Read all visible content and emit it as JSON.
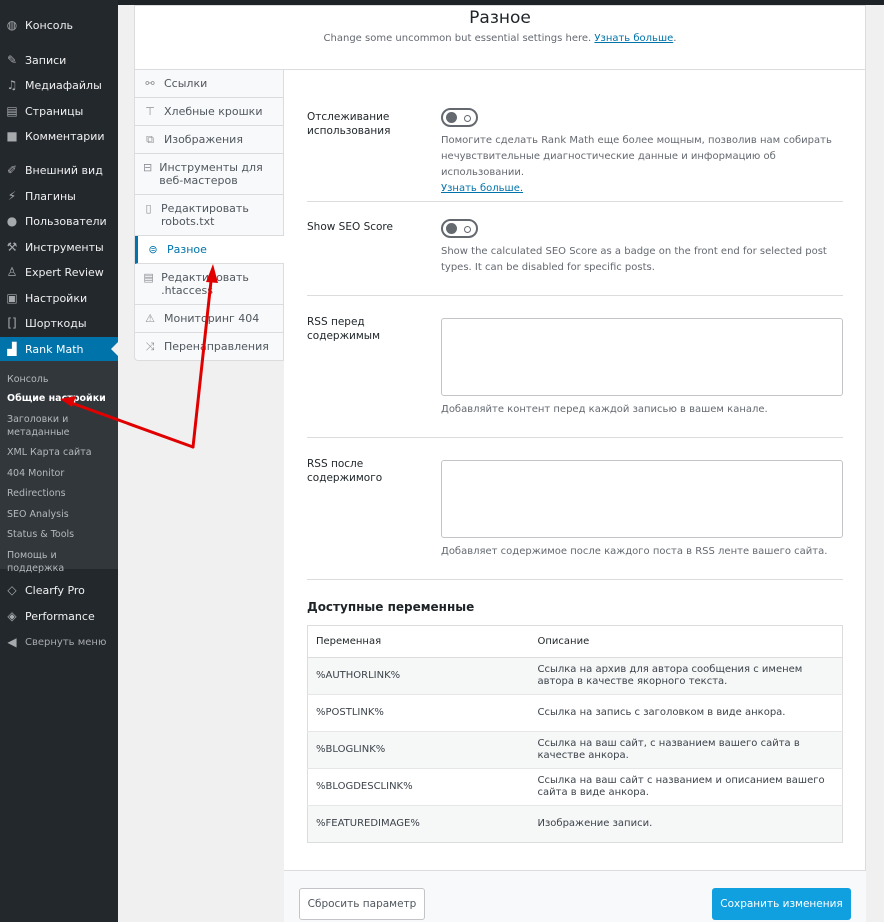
{
  "sidebar": {
    "items": [
      {
        "label": "Консоль",
        "icon": "dashboard-icon"
      },
      {
        "label": "Записи",
        "icon": "pin-icon"
      },
      {
        "label": "Медиафайлы",
        "icon": "media-icon"
      },
      {
        "label": "Страницы",
        "icon": "pages-icon"
      },
      {
        "label": "Комментарии",
        "icon": "comment-icon"
      },
      {
        "label": "Внешний вид",
        "icon": "brush-icon"
      },
      {
        "label": "Плагины",
        "icon": "plugin-icon"
      },
      {
        "label": "Пользователи",
        "icon": "user-icon"
      },
      {
        "label": "Инструменты",
        "icon": "wrench-icon"
      },
      {
        "label": "Expert Review",
        "icon": "expert-icon"
      },
      {
        "label": "Настройки",
        "icon": "settings-icon"
      },
      {
        "label": "Шорткоды",
        "icon": "brackets-icon"
      },
      {
        "label": "Rank Math",
        "icon": "rankmath-icon"
      },
      {
        "label": "Clearfy Pro",
        "icon": "diamond-icon"
      },
      {
        "label": "Performance",
        "icon": "performance-icon"
      },
      {
        "label": "Свернуть меню",
        "icon": "collapse-icon"
      }
    ],
    "submenu": [
      "Консоль",
      "Общие настройки",
      "Заголовки и метаданные",
      "XML Карта сайта",
      "404 Monitor",
      "Redirections",
      "SEO Analysis",
      "Status & Tools",
      "Помощь и поддержка"
    ]
  },
  "header": {
    "title": "Разное",
    "subtitle": "Change some uncommon but essential settings here.",
    "link": "Узнать больше"
  },
  "tabs": [
    {
      "label": "Ссылки",
      "icon": "link-icon"
    },
    {
      "label": "Хлебные крошки",
      "icon": "signpost-icon"
    },
    {
      "label": "Изображения",
      "icon": "images-icon"
    },
    {
      "label": "Инструменты для веб-мастеров",
      "icon": "toolbox-icon"
    },
    {
      "label": "Редактировать robots.txt",
      "icon": "file-icon"
    },
    {
      "label": "Разное",
      "icon": "misc-icon"
    },
    {
      "label": "Редактировать .htaccess",
      "icon": "document-icon"
    },
    {
      "label": "Мониторинг 404",
      "icon": "warning-icon"
    },
    {
      "label": "Перенаправления",
      "icon": "shuffle-icon"
    }
  ],
  "settings": {
    "usage": {
      "label": "Отслеживание использования",
      "enabled": false,
      "desc": "Помогите сделать Rank Math еще более мощным, позволив нам собирать нечувствительные диагностические данные и информацию об использовании.",
      "link": "Узнать больше."
    },
    "seo_score": {
      "label": "Show SEO Score",
      "enabled": false,
      "desc": "Show the calculated SEO Score as a badge on the front end for selected post types. It can be disabled for specific posts."
    },
    "rss_before": {
      "label": "RSS перед содержимым",
      "value": "",
      "desc": "Добавляйте контент перед каждой записью в вашем канале."
    },
    "rss_after": {
      "label": "RSS после содержимого",
      "value": "",
      "desc": "Добавляет содержимое после каждого поста в RSS ленте вашего сайта."
    }
  },
  "variables": {
    "title": "Доступные переменные",
    "headers": [
      "Переменная",
      "Описание"
    ],
    "rows": [
      [
        "%AUTHORLINK%",
        "Ссылка на архив для автора сообщения с именем автора в качестве якорного текста."
      ],
      [
        "%POSTLINK%",
        "Ссылка на запись с заголовком в виде анкора."
      ],
      [
        "%BLOGLINK%",
        "Ссылка на ваш сайт, с названием вашего сайта в качестве анкора."
      ],
      [
        "%BLOGDESCLINK%",
        "Ссылка на ваш сайт с названием и описанием вашего сайта в виде анкора."
      ],
      [
        "%FEATUREDIMAGE%",
        "Изображение записи."
      ]
    ]
  },
  "footer": {
    "reset": "Сбросить параметр",
    "save": "Сохранить изменения"
  },
  "colors": {
    "accent": "#0073aa",
    "save": "#10a0e0",
    "annotation": "#e00000"
  }
}
